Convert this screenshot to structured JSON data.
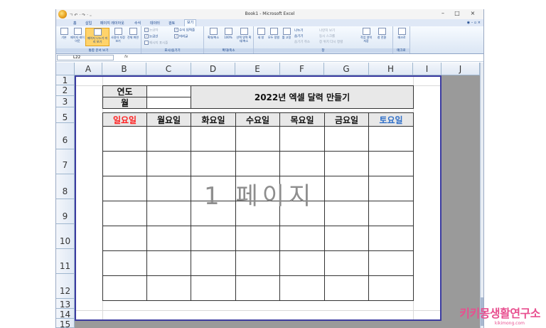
{
  "window": {
    "title": "Book1 - Microsoft Excel",
    "qat": "ㄱ ↶ · ↷ · ₌",
    "controls": [
      "–",
      "□",
      "×"
    ]
  },
  "ribbon_tabs": [
    "홈",
    "삽입",
    "페이지 레이아웃",
    "수식",
    "데이터",
    "검토",
    "보기"
  ],
  "active_tab": "보기",
  "help": "◉ – ▫ ×",
  "ribbon": {
    "view_group": {
      "label": "통합 문서 보기",
      "buttons": [
        "기본",
        "페이지 레이아웃",
        "페이지 나누기 미리 보기",
        "사용자 지정 보기",
        "전체 화면"
      ]
    },
    "show_group": {
      "label": "표시/숨기기",
      "checks": [
        {
          "label": "눈금자",
          "checked": true,
          "dim": true
        },
        {
          "label": "수식 입력줄",
          "checked": true,
          "dim": false
        },
        {
          "label": "눈금선",
          "checked": true,
          "dim": false
        },
        {
          "label": "머리글",
          "checked": true,
          "dim": false
        },
        {
          "label": "메시지 표시줄",
          "checked": false,
          "dim": true
        }
      ]
    },
    "zoom_group": {
      "label": "확대/축소",
      "buttons": [
        "확대/축소",
        "100%",
        "선택 영역 확대/축소"
      ]
    },
    "window_group": {
      "label": "창",
      "buttons": [
        "새 창",
        "모두 정렬",
        "틀 고정"
      ],
      "small": [
        "나누기",
        "숨기기",
        "숨기기 취소",
        "나란히 보기",
        "동시 스크롤",
        "창 위치 다시 정렬",
        "작업 영역 저장",
        "창 전환"
      ]
    },
    "macro_group": {
      "label": "매크로",
      "buttons": [
        "매크로"
      ]
    }
  },
  "formula_bar": {
    "name_box": "L22",
    "fx": "fx"
  },
  "columns": [
    "A",
    "B",
    "C",
    "D",
    "E",
    "F",
    "G",
    "H",
    "I",
    "J"
  ],
  "rows": [
    "1",
    "2",
    "3",
    "5",
    "6",
    "7",
    "8",
    "9",
    "10",
    "11",
    "12",
    "13",
    "14",
    "15"
  ],
  "calendar": {
    "year_label": "연도",
    "month_label": "월",
    "title": "2022년 엑셀 달력 만들기",
    "weekdays": [
      {
        "label": "일요일",
        "color": "#ff2020"
      },
      {
        "label": "월요일",
        "color": "#111111"
      },
      {
        "label": "화요일",
        "color": "#111111"
      },
      {
        "label": "수요일",
        "color": "#111111"
      },
      {
        "label": "목요일",
        "color": "#111111"
      },
      {
        "label": "금요일",
        "color": "#111111"
      },
      {
        "label": "토요일",
        "color": "#2f6fc8"
      }
    ]
  },
  "watermark": "1 페이지",
  "brand": {
    "name": "키키몽생활연구소",
    "url": "kikimong.com"
  }
}
